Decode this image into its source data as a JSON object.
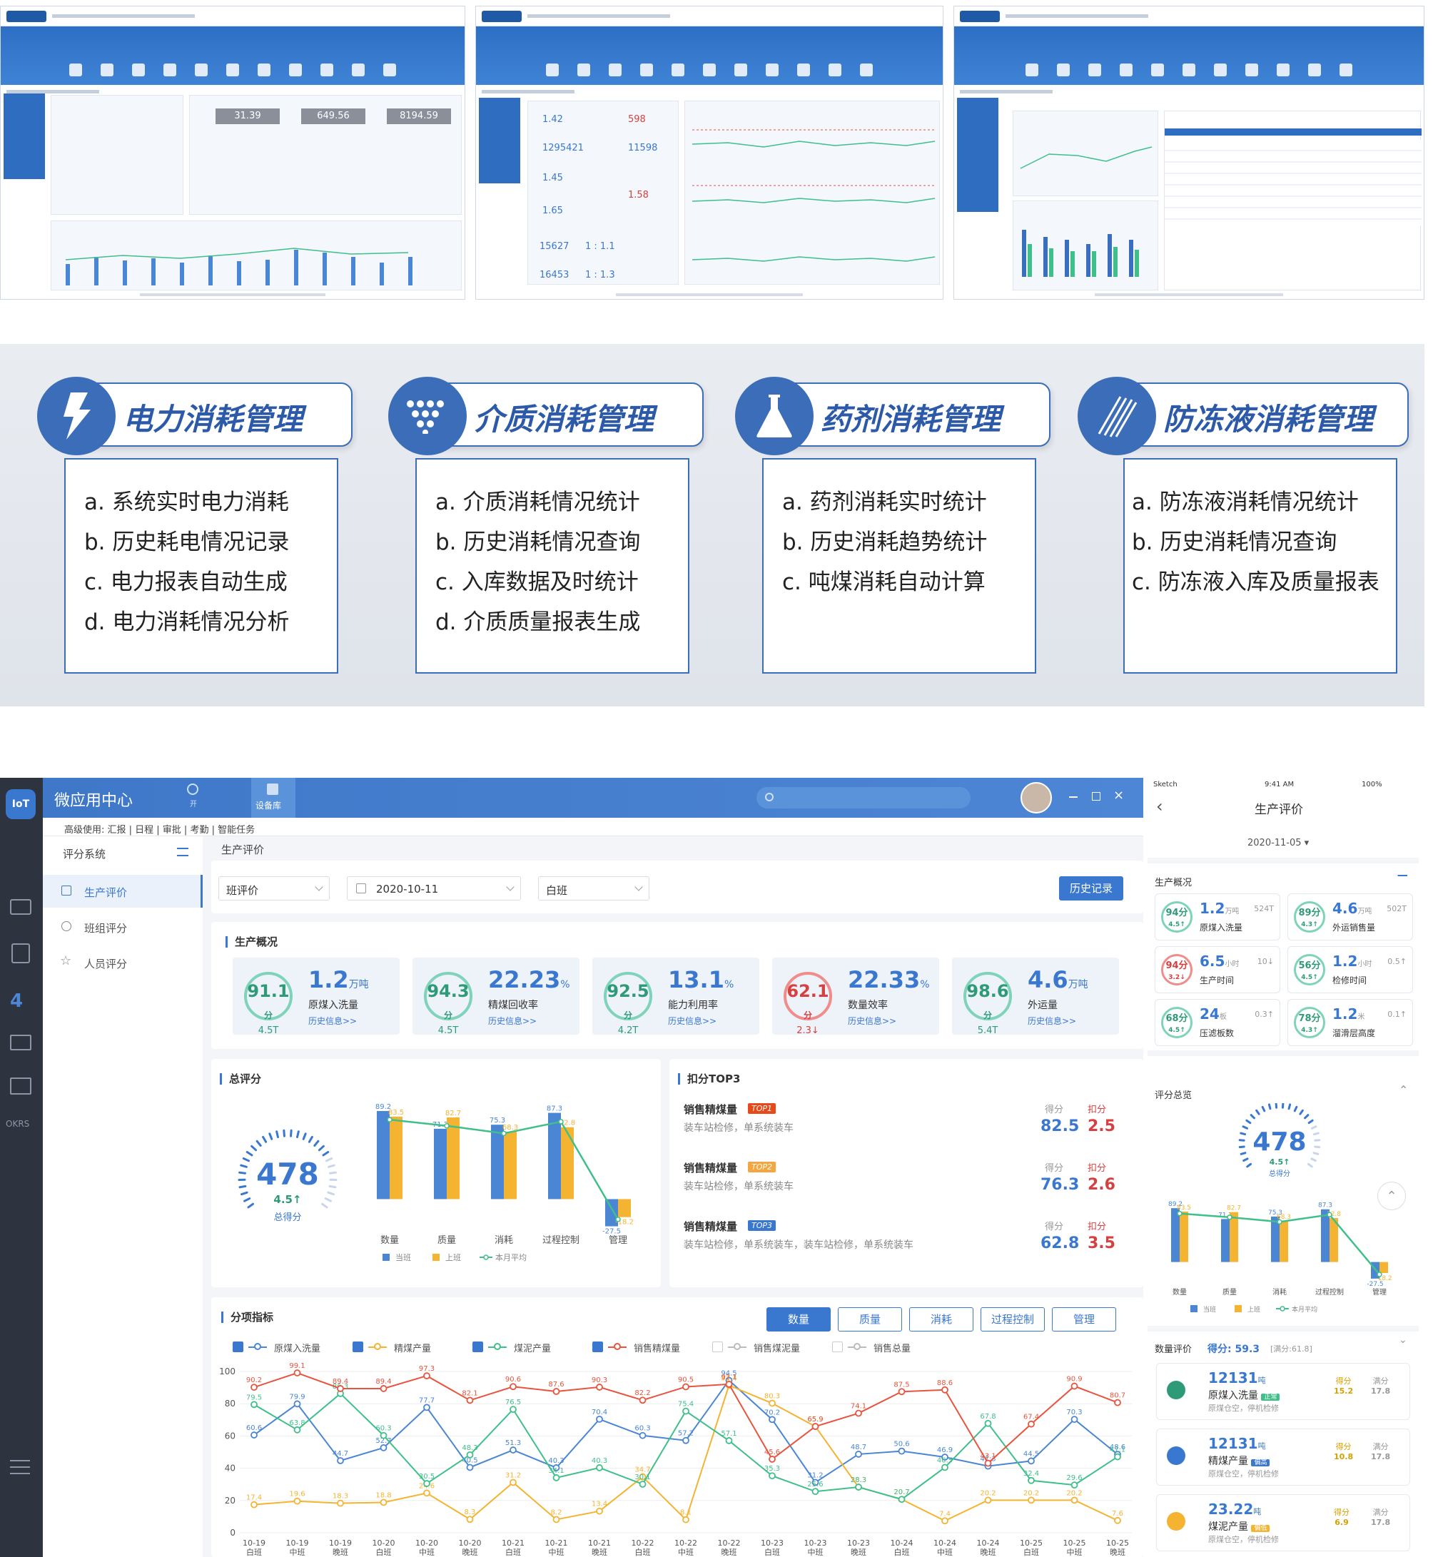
{
  "categories": [
    {
      "title": "电力消耗管理",
      "icon": "lightning-icon",
      "items": [
        "a.  系统实时电力消耗",
        "b.  历史耗电情况记录",
        "c.  电力报表自动生成",
        "d.  电力消耗情况分析"
      ]
    },
    {
      "title": "介质消耗管理",
      "icon": "dots-triangle-icon",
      "items": [
        "a.  介质消耗情况统计",
        "b.  历史消耗情况查询",
        "c.  入库数据及时统计",
        "d.  介质质量报表生成"
      ]
    },
    {
      "title": "药剂消耗管理",
      "icon": "flask-icon",
      "items": [
        "a.  药剂消耗实时统计",
        "b.  历史消耗趋势统计",
        "c.  吨煤消耗自动计算"
      ]
    },
    {
      "title": "防冻液消耗管理",
      "icon": "diagonal-lines-icon",
      "items": [
        "a.  防冻液消耗情况统计",
        "b.  历史消耗情况查询",
        "c.  防冻液入库及质量报表"
      ]
    }
  ],
  "thumbs": {
    "t1_values": [
      "31.39",
      "649.56",
      "8194.59"
    ],
    "t2_values": [
      "1.42",
      "598",
      "1295421",
      "11598",
      "1.45",
      "1.58",
      "1.65",
      "15627",
      "1 : 1.1",
      "16453",
      "1 : 1.3"
    ]
  },
  "app": {
    "title": "微应用中心",
    "logo": "IoT",
    "top_tab": "设备库",
    "top_tab_prev": "开",
    "nav_crumb": "高级使用: 汇报 | 日程 | 审批 | 考勤 | 智能任务",
    "okrs": "OKRS",
    "side_header": "评分系统",
    "side_items": [
      "生产评价",
      "班组评分",
      "人员评分"
    ],
    "page_title": "生产评价",
    "filter_type": "班评价",
    "filter_date": "2020-10-11",
    "filter_shift": "白班",
    "history_button": "历史记录",
    "overview_title": "生产概况",
    "kpis": [
      {
        "score": "91.1",
        "score_unit": "分",
        "sub": "4.5T",
        "value": "1.2",
        "unit": "万吨",
        "label": "原煤入洗量",
        "link": "历史信息>>",
        "red": false
      },
      {
        "score": "94.3",
        "score_unit": "分",
        "sub": "4.5T",
        "value": "22.23",
        "unit": "%",
        "label": "精煤回收率",
        "link": "历史信息>>",
        "red": false
      },
      {
        "score": "92.5",
        "score_unit": "分",
        "sub": "4.2T",
        "value": "13.1",
        "unit": "%",
        "label": "能力利用率",
        "link": "历史信息>>",
        "red": false
      },
      {
        "score": "62.1",
        "score_unit": "分",
        "sub": "2.3↓",
        "value": "22.33",
        "unit": "%",
        "label": "数量效率",
        "link": "历史信息>>",
        "red": true
      },
      {
        "score": "98.6",
        "score_unit": "分",
        "sub": "5.4T",
        "value": "4.6",
        "unit": "万吨",
        "label": "外运量",
        "link": "历史信息>>",
        "red": false
      }
    ],
    "total_title": "总评分",
    "total_score": "478",
    "total_sub": "4.5↑",
    "total_label": "总得分",
    "deduct_title": "扣分TOP3",
    "top3": [
      {
        "name": "销售精煤量",
        "tag": "TOP1",
        "desc": "装车站检修，单系统装车",
        "score_h": "得分",
        "ded_h": "扣分",
        "score": "82.5",
        "ded": "2.5"
      },
      {
        "name": "销售精煤量",
        "tag": "TOP2",
        "desc": "装车站检修，单系统装车",
        "score_h": "得分",
        "ded_h": "扣分",
        "score": "76.3",
        "ded": "2.6"
      },
      {
        "name": "销售精煤量",
        "tag": "TOP3",
        "desc": "装车站检修，单系统装车，装车站检修，单系统装车",
        "score_h": "得分",
        "ded_h": "扣分",
        "score": "62.8",
        "ded": "3.5"
      }
    ],
    "index_title": "分项指标",
    "index_buttons": [
      "数量",
      "质量",
      "消耗",
      "过程控制",
      "管理"
    ],
    "legend_checks": [
      "原煤入洗量",
      "精煤产量",
      "煤泥产量",
      "销售精煤量",
      "销售煤泥量",
      "销售总量"
    ]
  },
  "mobile": {
    "status_left": "Sketch",
    "status_time": "9:41 AM",
    "status_right": "100%",
    "title": "生产评价",
    "date": "2020-11-05 ▾",
    "overview": "生产概况",
    "cards": [
      {
        "score": "94分",
        "sub": "4.5↑",
        "value": "1.2",
        "unit": "万吨",
        "extra": "524T",
        "label": "原煤入洗量",
        "red": false
      },
      {
        "score": "89分",
        "sub": "4.3↑",
        "value": "4.6",
        "unit": "万吨",
        "extra": "502T",
        "label": "外运销售量",
        "red": false
      },
      {
        "score": "94分",
        "sub": "3.2↓",
        "value": "6.5",
        "unit": "小时",
        "extra": "10↓",
        "label": "生产时间",
        "red": true
      },
      {
        "score": "56分",
        "sub": "4.5↑",
        "value": "1.2",
        "unit": "小时",
        "extra": "0.5↑",
        "label": "检修时间",
        "red": false
      },
      {
        "score": "68分",
        "sub": "4.5↑",
        "value": "24",
        "unit": "板",
        "extra": "0.3↑",
        "label": "压滤板数",
        "red": false
      },
      {
        "score": "78分",
        "sub": "4.3↑",
        "value": "1.2",
        "unit": "米",
        "extra": "0.1↑",
        "label": "溜滑层高度",
        "red": false
      }
    ],
    "score_overview": "评分总览",
    "score": "478",
    "score_sub": "4.5↑",
    "score_label": "总得分",
    "qty_eval": "数量评价",
    "qty_score": "得分: 59.3",
    "qty_full": "[满分:61.8]",
    "rows": [
      {
        "value": "12131",
        "unit": "吨",
        "label": "原煤入洗量",
        "badge": "正常",
        "desc": "原煤仓空，停机检修",
        "score": "15.2",
        "full": "17.8"
      },
      {
        "value": "12131",
        "unit": "吨",
        "label": "精煤产量",
        "badge": "偏高",
        "desc": "原煤仓空，停机检修",
        "score": "10.8",
        "full": "17.8"
      },
      {
        "value": "23.22",
        "unit": "吨",
        "label": "煤泥产量",
        "badge": "偏低",
        "desc": "原煤仓空，停机检修",
        "score": "6.9",
        "full": "17.8"
      }
    ],
    "score_h": "得分",
    "full_h": "满分"
  },
  "chart_data": [
    {
      "type": "bar",
      "categories": [
        "数量",
        "质量",
        "消耗",
        "过程控制",
        "管理"
      ],
      "series": [
        {
          "name": "当班",
          "values": [
            89.2,
            71.2,
            75.3,
            87.3,
            -27.5
          ]
        },
        {
          "name": "上班",
          "values": [
            83.5,
            82.7,
            68.3,
            72.8,
            -18.2
          ]
        },
        {
          "name": "本月平均",
          "values": [
            80.4,
            74.2,
            66.5,
            78.4,
            -20.5
          ]
        }
      ],
      "colors": [
        "#4a86d4",
        "#f4b431",
        "#3fbf8a"
      ],
      "ylim": [
        -30,
        100
      ]
    },
    {
      "type": "line",
      "x": [
        "10-19 白班",
        "10-19 中班",
        "10-19 晚班",
        "10-20 白班",
        "10-20 中班",
        "10-20 晚班",
        "10-21 白班",
        "10-21 中班",
        "10-21 晚班",
        "10-22 白班",
        "10-22 中班",
        "10-22 晚班",
        "10-23 白班",
        "10-23 中班",
        "10-23 晚班",
        "10-24 白班",
        "10-24 中班",
        "10-24 晚班",
        "10-25 白班",
        "10-25 中班",
        "10-25 晚班"
      ],
      "x_lines": [
        [
          "10-19",
          "白班"
        ],
        [
          "10-19",
          "中班"
        ],
        [
          "10-19",
          "晚班"
        ],
        [
          "10-20",
          "白班"
        ],
        [
          "10-20",
          "中班"
        ],
        [
          "10-20",
          "晚班"
        ],
        [
          "10-21",
          "白班"
        ],
        [
          "10-21",
          "中班"
        ],
        [
          "10-21",
          "晚班"
        ],
        [
          "10-22",
          "白班"
        ],
        [
          "10-22",
          "中班"
        ],
        [
          "10-22",
          "晚班"
        ],
        [
          "10-23",
          "白班"
        ],
        [
          "10-23",
          "中班"
        ],
        [
          "10-23",
          "晚班"
        ],
        [
          "10-24",
          "白班"
        ],
        [
          "10-24",
          "中班"
        ],
        [
          "10-24",
          "晚班"
        ],
        [
          "10-25",
          "白班"
        ],
        [
          "10-25",
          "中班"
        ],
        [
          "10-25",
          "晚班"
        ]
      ],
      "ylim": [
        0,
        100
      ],
      "yticks": [
        0,
        20,
        40,
        60,
        80,
        100
      ],
      "series": [
        {
          "name": "原煤入洗量",
          "color": "#4a86d4",
          "values": [
            60.6,
            79.9,
            44.7,
            52.7,
            77.7,
            40.5,
            51.3,
            40.3,
            70.4,
            60.3,
            57.2,
            94.5,
            70.2,
            31.2,
            48.7,
            50.6,
            46.9,
            41.3,
            44.5,
            70.3,
            48.6
          ]
        },
        {
          "name": "精煤产量",
          "color": "#f4b431",
          "values": [
            17.4,
            19.6,
            18.3,
            18.8,
            24.6,
            8.3,
            31.2,
            8.2,
            13.4,
            34.7,
            8.1,
            91.4,
            80.3,
            65.9,
            28.3,
            20.7,
            7.4,
            20.2,
            20.2,
            20.2,
            7.6
          ]
        },
        {
          "name": "煤泥产量",
          "color": "#3fbf8a",
          "values": [
            79.5,
            63.8,
            86.3,
            60.3,
            30.5,
            48.3,
            76.5,
            34.1,
            40.3,
            30.1,
            75.4,
            57.1,
            35.3,
            25.6,
            28.3,
            20.7,
            40.5,
            67.8,
            32.4,
            29.6,
            47.1
          ]
        },
        {
          "name": "销售精煤量",
          "color": "#e8543e",
          "values": [
            90.2,
            99.1,
            89.4,
            89.4,
            97.3,
            82.1,
            90.6,
            87.6,
            90.3,
            82.2,
            90.5,
            92.1,
            45.6,
            65.9,
            74.1,
            87.5,
            88.6,
            43.1,
            67.4,
            90.9,
            80.7
          ]
        }
      ]
    }
  ]
}
